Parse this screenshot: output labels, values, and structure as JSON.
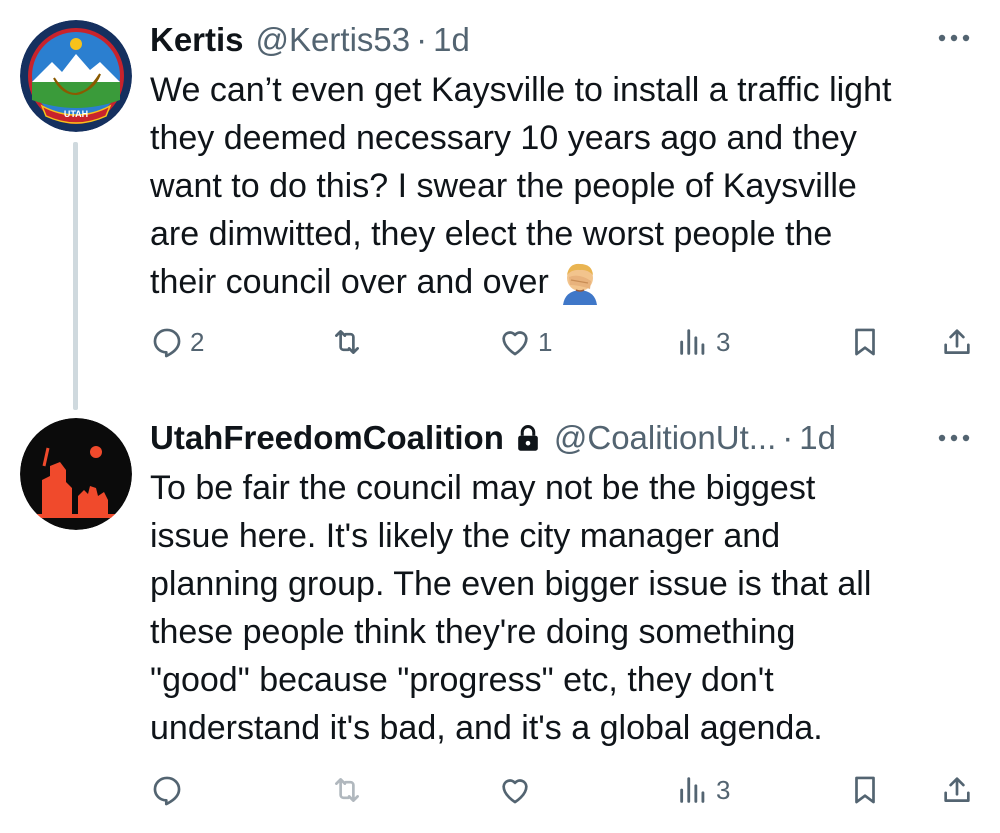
{
  "tweets": [
    {
      "name": "Kertis",
      "handle": "@Kertis53",
      "separator": "·",
      "time": "1d",
      "lines": [
        "We can’t even get Kaysville to install a traffic light",
        "they deemed necessary 10 years ago and they",
        "want to do this? I swear the people of Kaysville",
        "are dimwitted, they elect the worst people the",
        "their council over and over"
      ],
      "emoji": "face-palm-emoji",
      "avatar_badge_text": "UTAH",
      "counts": {
        "reply": "2",
        "retweet": "",
        "like": "1",
        "views": "3"
      }
    },
    {
      "name": "UtahFreedomCoalition",
      "handle": "@CoalitionUt...",
      "separator": "·",
      "time": "1d",
      "lines": [
        "To be fair the council may not be the biggest",
        "issue here. It's likely the city manager and",
        "planning group. The even bigger issue is that all",
        "these people think they're doing something",
        "\"good\" because \"progress\" etc, they don't",
        "understand it's bad, and it's a global agenda."
      ],
      "counts": {
        "reply": "",
        "retweet": "",
        "like": "",
        "views": "3"
      }
    }
  ],
  "colors": {
    "text": "#0f1419",
    "secondary": "#536471",
    "thread_line": "#cfd9de",
    "avatar2_bg": "#0b0b0b",
    "avatar2_accent": "#f04a2c"
  }
}
